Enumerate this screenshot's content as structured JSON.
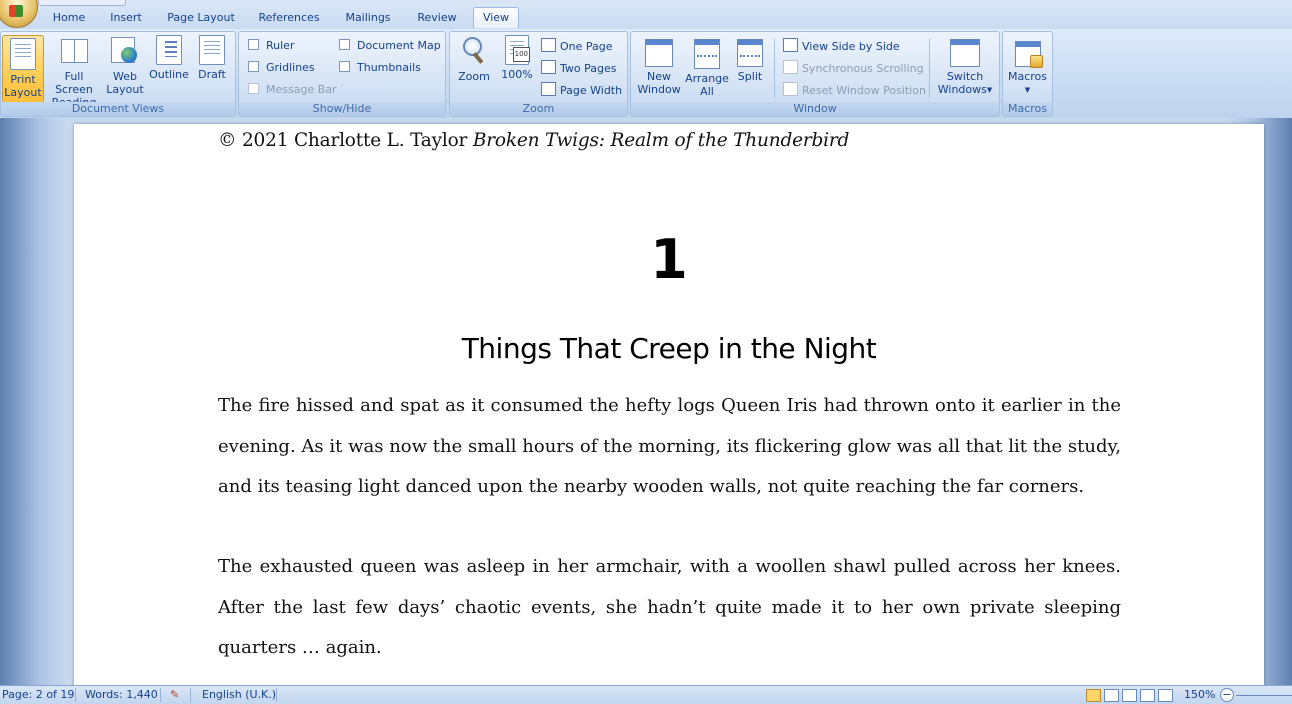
{
  "tabs": [
    "Home",
    "Insert",
    "Page Layout",
    "References",
    "Mailings",
    "Review",
    "View"
  ],
  "active_tab": "View",
  "ribbon": {
    "document_views": {
      "label": "Document Views",
      "print_layout": [
        "Print",
        "Layout"
      ],
      "full_screen": [
        "Full Screen",
        "Reading"
      ],
      "web_layout": [
        "Web",
        "Layout"
      ],
      "outline": "Outline",
      "draft": "Draft"
    },
    "show_hide": {
      "label": "Show/Hide",
      "ruler": "Ruler",
      "gridlines": "Gridlines",
      "message_bar": "Message Bar",
      "document_map": "Document Map",
      "thumbnails": "Thumbnails"
    },
    "zoom": {
      "label": "Zoom",
      "zoom": "Zoom",
      "hundred": "100%",
      "one_page": "One Page",
      "two_pages": "Two Pages",
      "page_width": "Page Width"
    },
    "window": {
      "label": "Window",
      "new_window": [
        "New",
        "Window"
      ],
      "arrange_all": [
        "Arrange",
        "All"
      ],
      "split": "Split",
      "view_side_by_side": "View Side by Side",
      "synchronous_scrolling": "Synchronous Scrolling",
      "reset_window_position": "Reset Window Position",
      "switch_windows": [
        "Switch",
        "Windows"
      ]
    },
    "macros": {
      "label": "Macros",
      "macros": "Macros"
    }
  },
  "document": {
    "header_plain": "© 2021 Charlotte L. Taylor ",
    "header_italic": "Broken Twigs: Realm of the Thunderbird",
    "chapter_number": "1",
    "chapter_title": "Things That Creep in the Night",
    "paragraph1": "The fire hissed and spat as it consumed the hefty logs Queen Iris had thrown onto it earlier in the evening. As it was now the small hours of the morning, its flickering glow was all that lit the study, and its teasing light danced upon the nearby wooden walls, not quite reaching the far corners.",
    "paragraph2": "The exhausted queen was asleep in her armchair, with a woollen shawl pulled across her knees. After the last few days’ chaotic events, she hadn’t quite made it to her own private sleeping quarters … again."
  },
  "status": {
    "page": "Page: 2 of 19",
    "words": "Words: 1,440",
    "language": "English (U.K.)",
    "zoom": "150%"
  }
}
